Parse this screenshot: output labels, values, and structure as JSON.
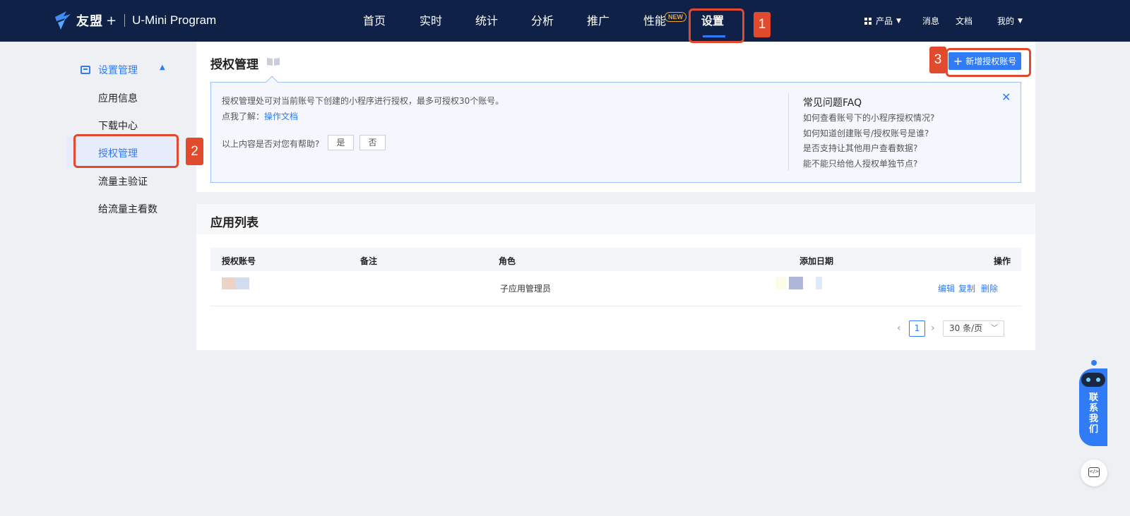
{
  "header": {
    "brand": "友盟",
    "brand_plus": "+",
    "product": "U-Mini Program",
    "nav": [
      "首页",
      "实时",
      "统计",
      "分析",
      "推广",
      "性能",
      "设置"
    ],
    "new_badge": "NEW",
    "right": {
      "product_menu": "产品",
      "messages": "消息",
      "docs": "文档",
      "mine": "我的"
    }
  },
  "annotations": [
    "1",
    "2",
    "3"
  ],
  "sidebar": {
    "group": "设置管理",
    "items": [
      "应用信息",
      "下载中心",
      "授权管理",
      "流量主验证",
      "给流量主看数"
    ],
    "active": "授权管理"
  },
  "auth": {
    "title": "授权管理",
    "add_button": "新增授权账号",
    "info_text": "授权管理处可对当前账号下创建的小程序进行授权，最多可授权30个账号。",
    "learn_prefix": "点我了解：",
    "learn_link": "操作文档",
    "helpful_q": "以上内容是否对您有帮助?",
    "yes": "是",
    "no": "否",
    "faq_title": "常见问题FAQ",
    "faq": [
      "如何查看账号下的小程序授权情况?",
      "如何知道创建账号/授权账号是谁?",
      "是否支持让其他用户查看数据?",
      "能不能只给他人授权单独节点?"
    ]
  },
  "app_list": {
    "title": "应用列表",
    "columns": [
      "授权账号",
      "备注",
      "角色",
      "添加日期",
      "操作"
    ],
    "rows": [
      {
        "account": "",
        "remark": "",
        "role": "子应用管理员",
        "date": "",
        "actions": [
          "编辑",
          "复制",
          "删除"
        ]
      }
    ],
    "pager": {
      "current": "1",
      "page_size": "30 条/页"
    }
  },
  "widgets": {
    "contact": "联系我们"
  },
  "colors": {
    "nav_bg": "#0f2147",
    "accent": "#2f7cf6",
    "annotation": "#e14a2c"
  }
}
